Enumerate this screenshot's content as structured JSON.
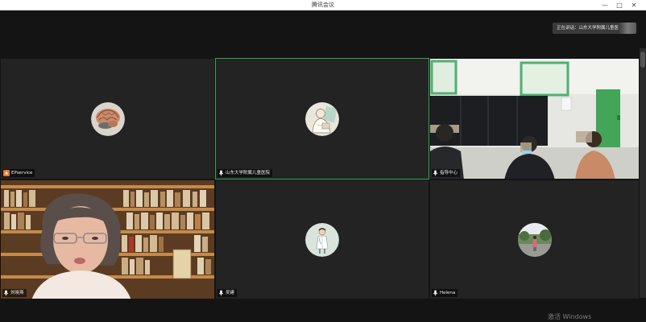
{
  "window": {
    "title": "腾讯会议",
    "controls": [
      "—",
      "□",
      "✕"
    ]
  },
  "active_speaker": {
    "label": "正在讲话：山东大学附属儿童医..."
  },
  "participants": [
    {
      "name": "EPservice",
      "mic": "mic-muted-icon",
      "avatar": "brain-icon"
    },
    {
      "name": "山东大学附属儿童医院",
      "mic": "mic-icon",
      "avatar": "doctor-sketch-icon"
    },
    {
      "name": "指导中心",
      "mic": "mic-icon",
      "avatar": "video-feed"
    },
    {
      "name": "刘晓燕",
      "mic": "mic-icon",
      "avatar": "video-feed"
    },
    {
      "name": "吴建",
      "mic": "mic-icon",
      "avatar": "doctor-figure-icon"
    },
    {
      "name": "Helena",
      "mic": "mic-icon",
      "avatar": "photo-icon"
    }
  ],
  "watermark": "激活 Windows",
  "colors": {
    "background": "#141414",
    "tile": "#232323",
    "active_border": "#2fa84f",
    "muted": "#e8752a"
  }
}
